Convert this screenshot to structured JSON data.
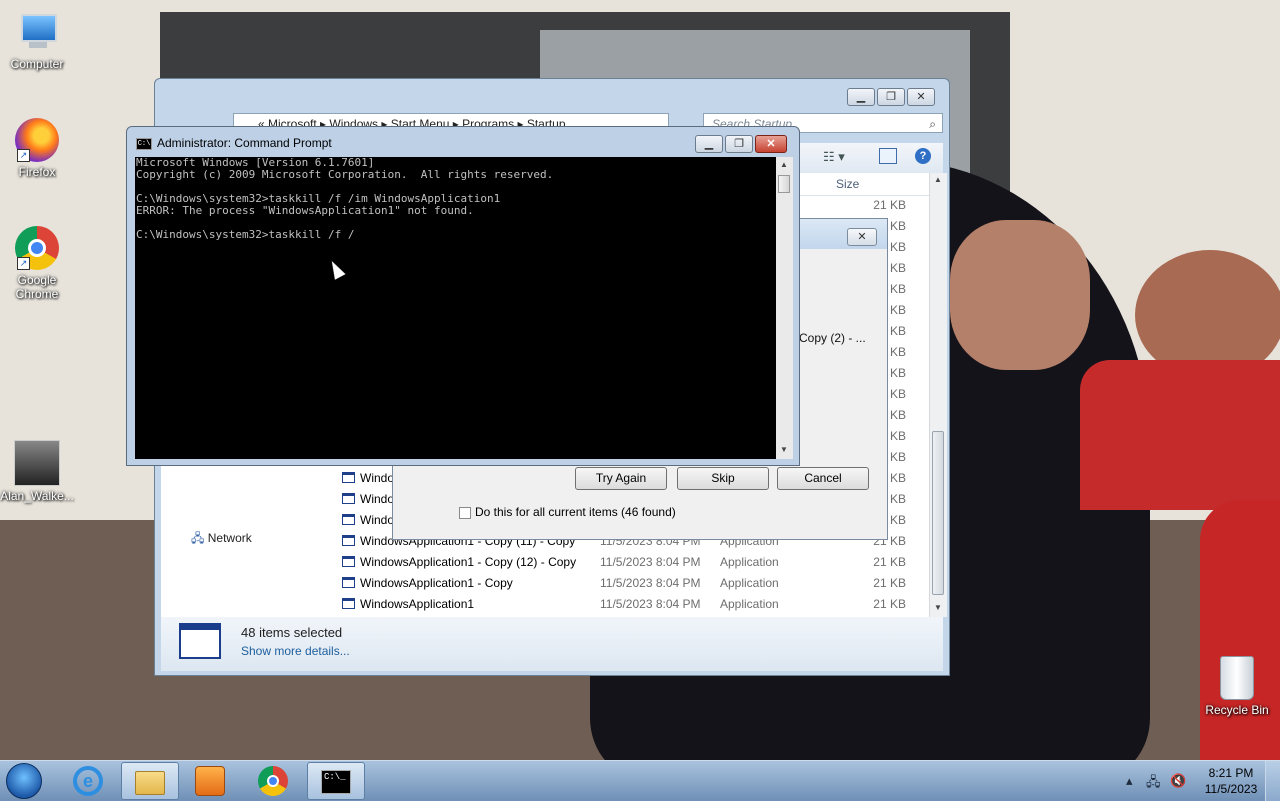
{
  "desktop": {
    "icons": [
      {
        "label": "Computer",
        "icon": "computer-icon"
      },
      {
        "label": "Firefox",
        "icon": "firefox-icon"
      },
      {
        "label": "Google Chrome",
        "icon": "chrome-icon"
      },
      {
        "label": "Alan_Walke...",
        "icon": "image-file-icon"
      },
      {
        "label": "Recycle Bin",
        "icon": "recycle-bin-icon"
      }
    ]
  },
  "explorer": {
    "address_parts": [
      "«",
      "Microsoft",
      "Windows",
      "Start Menu",
      "Programs",
      "Startup"
    ],
    "address_text": "«  Microsoft  ▸  Windows  ▸  Start Menu  ▸  Programs  ▸  Startup",
    "search_placeholder": "Search Startup",
    "column_size": "Size",
    "nav_network": "Network",
    "rows": [
      {
        "name": "",
        "date": "",
        "type": "",
        "size": "21 KB"
      },
      {
        "name": "",
        "date": "",
        "type": "",
        "size": "KB"
      },
      {
        "name": "",
        "date": "",
        "type": "",
        "size": "KB"
      },
      {
        "name": "",
        "date": "",
        "type": "",
        "size": "KB"
      },
      {
        "name": "",
        "date": "",
        "type": "",
        "size": "KB"
      },
      {
        "name": "",
        "date": "",
        "type": "",
        "size": "KB"
      },
      {
        "name": "",
        "date": "",
        "type": "",
        "size": "KB"
      },
      {
        "name": "",
        "date": "",
        "type": "",
        "size": "KB"
      },
      {
        "name": "",
        "date": "",
        "type": "",
        "size": "KB"
      },
      {
        "name": "",
        "date": "",
        "type": "",
        "size": "KB"
      },
      {
        "name": "",
        "date": "",
        "type": "",
        "size": "KB"
      },
      {
        "name": "",
        "date": "",
        "type": "",
        "size": "KB"
      },
      {
        "name": "",
        "date": "",
        "type": "",
        "size": "KB"
      },
      {
        "name": "Windo",
        "date": "",
        "type": "",
        "size": "KB"
      },
      {
        "name": "Windo",
        "date": "",
        "type": "",
        "size": "KB"
      },
      {
        "name": "Windo",
        "date": "",
        "type": "",
        "size": "KB"
      },
      {
        "name": "WindowsApplication1 - Copy (11) - Copy",
        "date": "11/5/2023 8:04 PM",
        "type": "Application",
        "size": "21 KB"
      },
      {
        "name": "WindowsApplication1 - Copy (12) - Copy",
        "date": "11/5/2023 8:04 PM",
        "type": "Application",
        "size": "21 KB"
      },
      {
        "name": "WindowsApplication1 - Copy",
        "date": "11/5/2023 8:04 PM",
        "type": "Application",
        "size": "21 KB"
      },
      {
        "name": "WindowsApplication1",
        "date": "11/5/2023 8:04 PM",
        "type": "Application",
        "size": "21 KB"
      }
    ],
    "status_count": "48 items selected",
    "status_link": "Show more details..."
  },
  "dialog": {
    "snippet": "Copy (2) - ...",
    "try_again": "Try Again",
    "skip": "Skip",
    "cancel": "Cancel",
    "checkbox_label": "Do this for all current items (46 found)",
    "checkbox_checked": false
  },
  "cmd": {
    "title": "Administrator: Command Prompt",
    "lines": [
      "Microsoft Windows [Version 6.1.7601]",
      "Copyright (c) 2009 Microsoft Corporation.  All rights reserved.",
      "",
      "C:\\Windows\\system32>taskkill /f /im WindowsApplication1",
      "ERROR: The process \"WindowsApplication1\" not found.",
      "",
      "C:\\Windows\\system32>taskkill /f /"
    ]
  },
  "taskbar": {
    "buttons": [
      "start-orb",
      "internet-explorer-icon",
      "folder-icon",
      "media-player-icon",
      "chrome-icon",
      "command-prompt-icon"
    ],
    "time": "8:21 PM",
    "date": "11/5/2023"
  }
}
